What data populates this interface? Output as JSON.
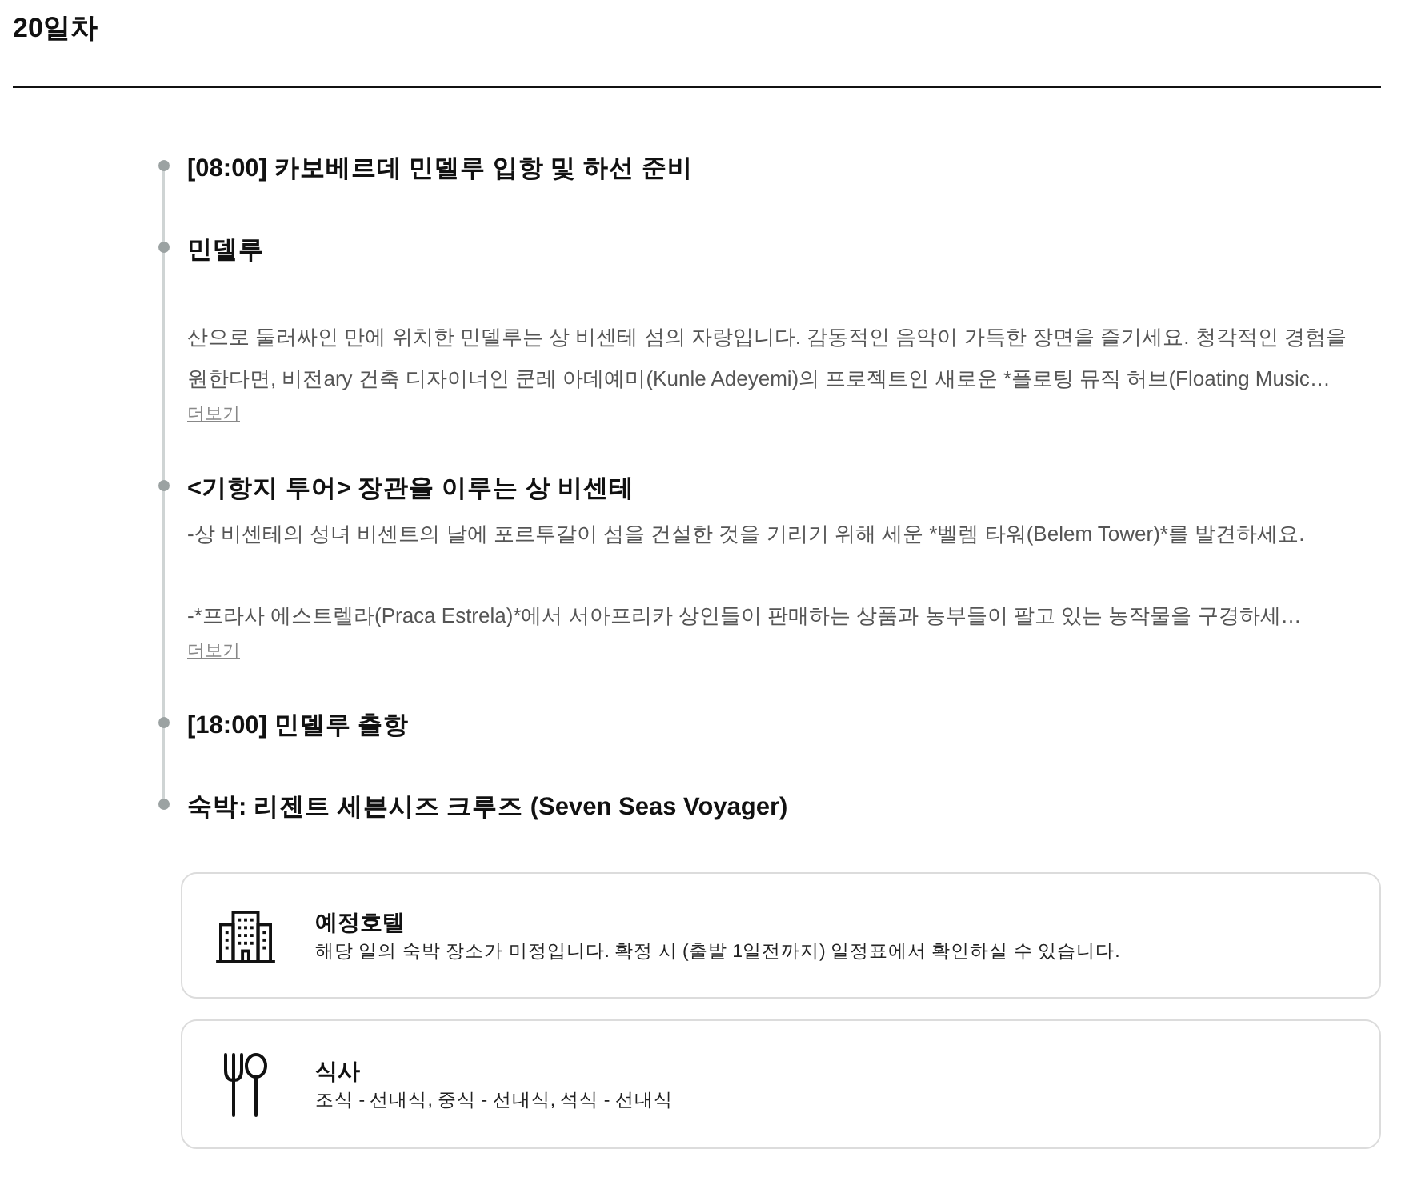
{
  "day_title": "20일차",
  "timeline": [
    {
      "title": "[08:00] 카보베르데 민델루 입항 및 하선 준비"
    },
    {
      "title": "민델루",
      "paragraphs": [
        "산으로 둘러싸인 만에 위치한 민델루는 상 비센테 섬의 자랑입니다. 감동적인 음악이 가득한 장면을 즐기세요. 청각적인 경험을 원한다면, 비전ary 건축 디자이너인 쿤레 아데예미(Kunle Adeyemi)의 프로젝트인 새로운 *플로팅 뮤직 허브(Floating Music…"
      ],
      "more_link": "더보기"
    },
    {
      "title": "<기항지 투어> 장관을 이루는 상 비센테",
      "paragraphs": [
        "-상 비센테의 성녀 비센트의 날에 포르투갈이 섬을 건설한 것을 기리기 위해 세운 *벨렘 타워(Belem Tower)*를 발견하세요.",
        "-*프라사 에스트렐라(Praca Estrela)*에서 서아프리카 상인들이 판매하는 상품과 농부들이 팔고 있는 농작물을 구경하세…"
      ],
      "more_link": "더보기"
    },
    {
      "title": "[18:00] 민델루 출항"
    },
    {
      "title": "숙박: 리젠트 세븐시즈 크루즈 (Seven Seas Voyager)"
    }
  ],
  "cards": [
    {
      "kind": "hotel",
      "title": "예정호텔",
      "text": "해당 일의 숙박 장소가 미정입니다. 확정 시 (출발 1일전까지) 일정표에서 확인하실 수 있습니다."
    },
    {
      "kind": "meal",
      "title": "식사",
      "text": "조식 - 선내식, 중식 - 선내식, 석식 - 선내식"
    }
  ]
}
